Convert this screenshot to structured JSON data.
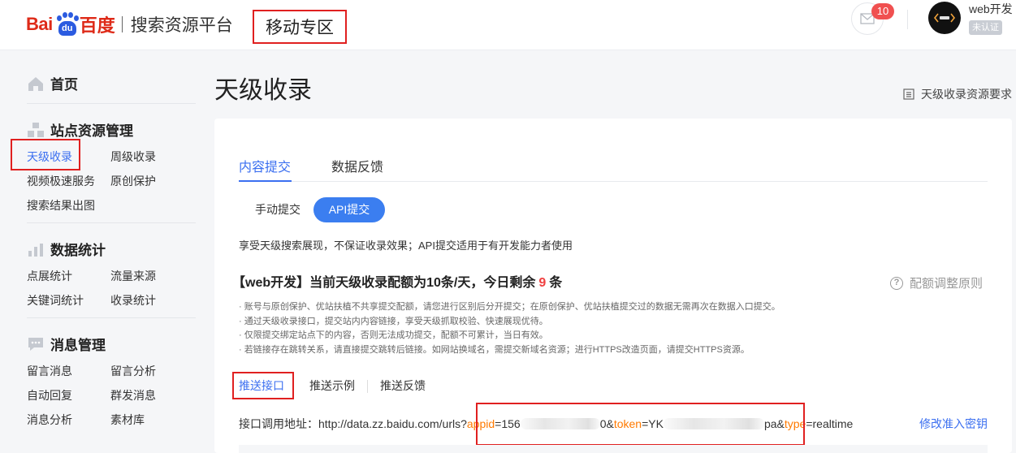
{
  "header": {
    "logo_bai": "Bai",
    "logo_paw_text": "du",
    "logo_du": "百度",
    "platform": "搜索资源平台",
    "zone": "移动专区",
    "message_count": "10",
    "user_name": "web开发",
    "user_badge": "未认证"
  },
  "sidebar": {
    "home": "首页",
    "site_section": "站点资源管理",
    "site_items": [
      "天级收录",
      "周级收录",
      "视频极速服务",
      "原创保护",
      "搜索结果出图"
    ],
    "stats_section": "数据统计",
    "stats_items": [
      "点展统计",
      "流量来源",
      "关键词统计",
      "收录统计"
    ],
    "msg_section": "消息管理",
    "msg_items": [
      "留言消息",
      "留言分析",
      "自动回复",
      "群发消息",
      "消息分析",
      "素材库"
    ]
  },
  "page": {
    "title": "天级收录",
    "requirements_link": "天级收录资源要求"
  },
  "card": {
    "tabs": [
      "内容提交",
      "数据反馈"
    ],
    "segments": [
      "手动提交",
      "API提交"
    ],
    "description": "享受天级搜索展现，不保证收录效果；API提交适用于有开发能力者使用",
    "quota_prefix": "【web开发】当前天级收录配额为10条/天，今日剩余",
    "quota_remaining": "9",
    "quota_suffix": "条",
    "rule_link": "配额调整原则",
    "notes": [
      "· 账号与原创保护、优站扶植不共享提交配额，请您进行区别后分开提交；在原创保护、优站扶植提交过的数据无需再次在数据入口提交。",
      "· 通过天级收录接口，提交站内内容链接，享受天级抓取校验、快速展现优待。",
      "· 仅限提交绑定站点下的内容，否则无法成功提交，配额不可累计，当日有效。",
      "· 若链接存在跳转关系，请直接提交跳转后链接。如网站换域名，需提交新域名资源；进行HTTPS改造页面，请提交HTTPS资源。"
    ],
    "subtabs": [
      "推送接口",
      "推送示例",
      "推送反馈"
    ],
    "api": {
      "label": "接口调用地址：",
      "base": "http://data.zz.baidu.com/urls",
      "q": "?",
      "appid_key": "appid",
      "eq1": "=156",
      "mid1": "0&",
      "token_key": "token",
      "eq2": "=YK",
      "mid2": "pa&",
      "type_key": "type",
      "eq3": "=realtime"
    },
    "modify_link": "修改准入密钥"
  },
  "colors": {
    "accent": "#3b6ff0",
    "highlight_box": "#e02020",
    "baidu_red": "#de2a18",
    "baidu_blue": "#2b5be0",
    "param_key": "#ff7a00"
  }
}
